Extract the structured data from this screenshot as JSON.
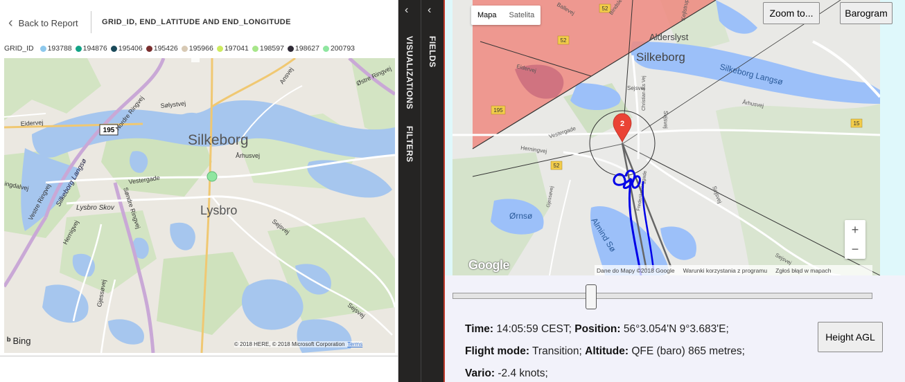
{
  "report": {
    "back_label": "Back to Report",
    "visual_title": "GRID_ID, END_LATITUDE AND END_LONGITUDE",
    "legend": {
      "title": "GRID_ID",
      "items": [
        {
          "label": "193788",
          "color": "#8dc8ec"
        },
        {
          "label": "194876",
          "color": "#13a386"
        },
        {
          "label": "195406",
          "color": "#1b4a5a"
        },
        {
          "label": "195426",
          "color": "#7a2e2e"
        },
        {
          "label": "195966",
          "color": "#d7c9b4"
        },
        {
          "label": "197041",
          "color": "#cdeb5f"
        },
        {
          "label": "198597",
          "color": "#a7e68a"
        },
        {
          "label": "198627",
          "color": "#2f2a36"
        },
        {
          "label": "200793",
          "color": "#8fe6a0"
        }
      ]
    },
    "map": {
      "labels": {
        "silkeborg": "Silkeborg",
        "lysbro": "Lysbro",
        "lysbro_skov": "Lysbro Skov",
        "silkeborg_langso": "Silkeborg Langsø",
        "vestergade": "Vestergade",
        "sondre_ringvej": "Søndre Ringvej",
        "nordre_ringvej": "Nordre Ringvej",
        "vestre_ringvej": "Vestre Ringvej",
        "arhusvej": "Århusvej",
        "sejsvej": "Sejsvej",
        "gjessovej": "Gjessøvej",
        "hernigvej": "Hernigvej",
        "eidervej": "Eidervej",
        "solystvej": "Sølystvej",
        "ostre_ringvej": "Østre Ringvej",
        "ansvej": "Ansvej",
        "ingdalvej": "ingdalvej",
        "route_195": "195"
      },
      "point_color": "#8fe6a0",
      "bing": "Bing",
      "attribution": "© 2018 HERE, © 2018 Microsoft Corporation",
      "terms": "Terms"
    }
  },
  "panes": {
    "visualizations": "VISUALIZATIONS",
    "filters": "FILTERS",
    "fields": "FIELDS"
  },
  "viewer": {
    "map_types": {
      "map": "Mapa",
      "satellite": "Satelita"
    },
    "zoom_button": "Zoom to...",
    "barogram_button": "Barogram",
    "zoom_in": "+",
    "zoom_out": "−",
    "google": "Google",
    "attribution": {
      "data": "Dane do Mapy ©2018 Google",
      "terms": "Warunki korzystania z programu",
      "report": "Zgłoś błąd w mapach"
    },
    "map_labels": {
      "alderslyst": "Alderslyst",
      "silkeborg": "Silkeborg",
      "silkeborg_langso": "Silkeborg Langsø",
      "almind_so": "Almind Sø",
      "ornso": "Ørnsø",
      "eidervej": "Eidervej",
      "vestergade": "Vestergade",
      "herningvej": "Herningvej",
      "sejsvej": "Sejsvej",
      "arhusvej": "Århusvej",
      "ballevej": "Ballevej",
      "bindslevgade": "Bindslevgade",
      "kejlstrup": "Kejlstrup",
      "christian": "Christian 8.s Vej",
      "gjessovej": "Gjessøvej",
      "frederiksberggade": "Frederiksberggade",
      "r52a": "52",
      "r52b": "52",
      "r52c": "52",
      "r195": "195",
      "r15": "15",
      "marker": "2"
    },
    "slider_position": 0.33,
    "info": {
      "time_label": "Time:",
      "time_value": "14:05:59 CEST;",
      "position_label": "Position:",
      "position_value": "56°3.054'N 9°3.683'E;",
      "flight_mode_label": "Flight mode:",
      "flight_mode_value": "Transition;",
      "altitude_label": "Altitude:",
      "altitude_value": "QFE (baro) 865 metres;",
      "vario_label": "Vario:",
      "vario_value": "-2.4 knots;"
    },
    "height_button": "Height AGL"
  }
}
